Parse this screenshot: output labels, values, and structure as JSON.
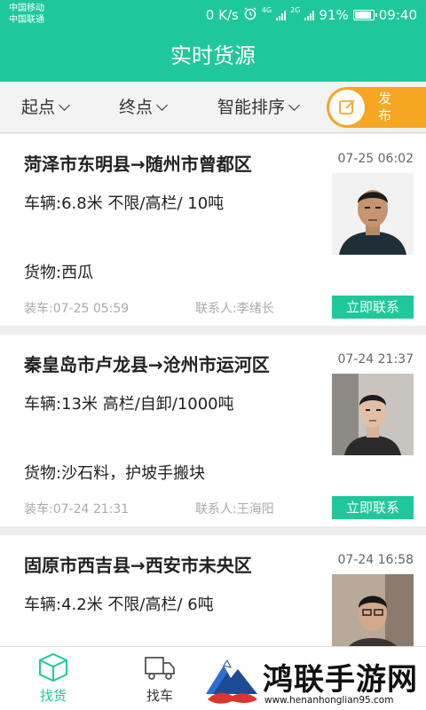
{
  "status_bar": {
    "carrier1": "中国移动",
    "carrier2": "中国联通",
    "speed": "0 K/s",
    "net1": "4G",
    "net2": "2G",
    "battery": "91%",
    "time": "09:40",
    "icons": [
      "alarm-icon",
      "signal-icon",
      "battery-icon"
    ]
  },
  "header": {
    "title": "实时货源"
  },
  "filters": {
    "origin": "起点",
    "destination": "终点",
    "sort": "智能排序",
    "publish_line1": "发",
    "publish_line2": "布"
  },
  "listings": [
    {
      "route": "菏泽市东明县→随州市曾都区",
      "time": "07-25 06:02",
      "vehicle": "车辆:6.8米  不限/高栏/  10吨",
      "cargo": "货物:西瓜",
      "loading": "装车:07-25 05:59",
      "contact": "联系人:李绪长",
      "contact_button": "立即联系"
    },
    {
      "route": "秦皇岛市卢龙县→沧州市运河区",
      "time": "07-24 21:37",
      "vehicle": "车辆:13米  高栏/自卸/1000吨",
      "cargo": "货物:沙石料，护坡手搬块",
      "loading": "装车:07-24 21:31",
      "contact": "联系人:王海阳",
      "contact_button": "立即联系"
    },
    {
      "route": "固原市西吉县→西安市未央区",
      "time": "07-24 16:58",
      "vehicle": "车辆:4.2米  不限/高栏/  6吨"
    }
  ],
  "bottom_nav": [
    {
      "label": "找货",
      "icon": "box-icon",
      "active": true
    },
    {
      "label": "找车",
      "icon": "truck-icon",
      "active": false
    }
  ],
  "watermark": {
    "title": "鸿联手游网",
    "url": "www.henanhonglian95.com"
  },
  "colors": {
    "primary": "#1fc89a",
    "accent": "#f6a623"
  }
}
